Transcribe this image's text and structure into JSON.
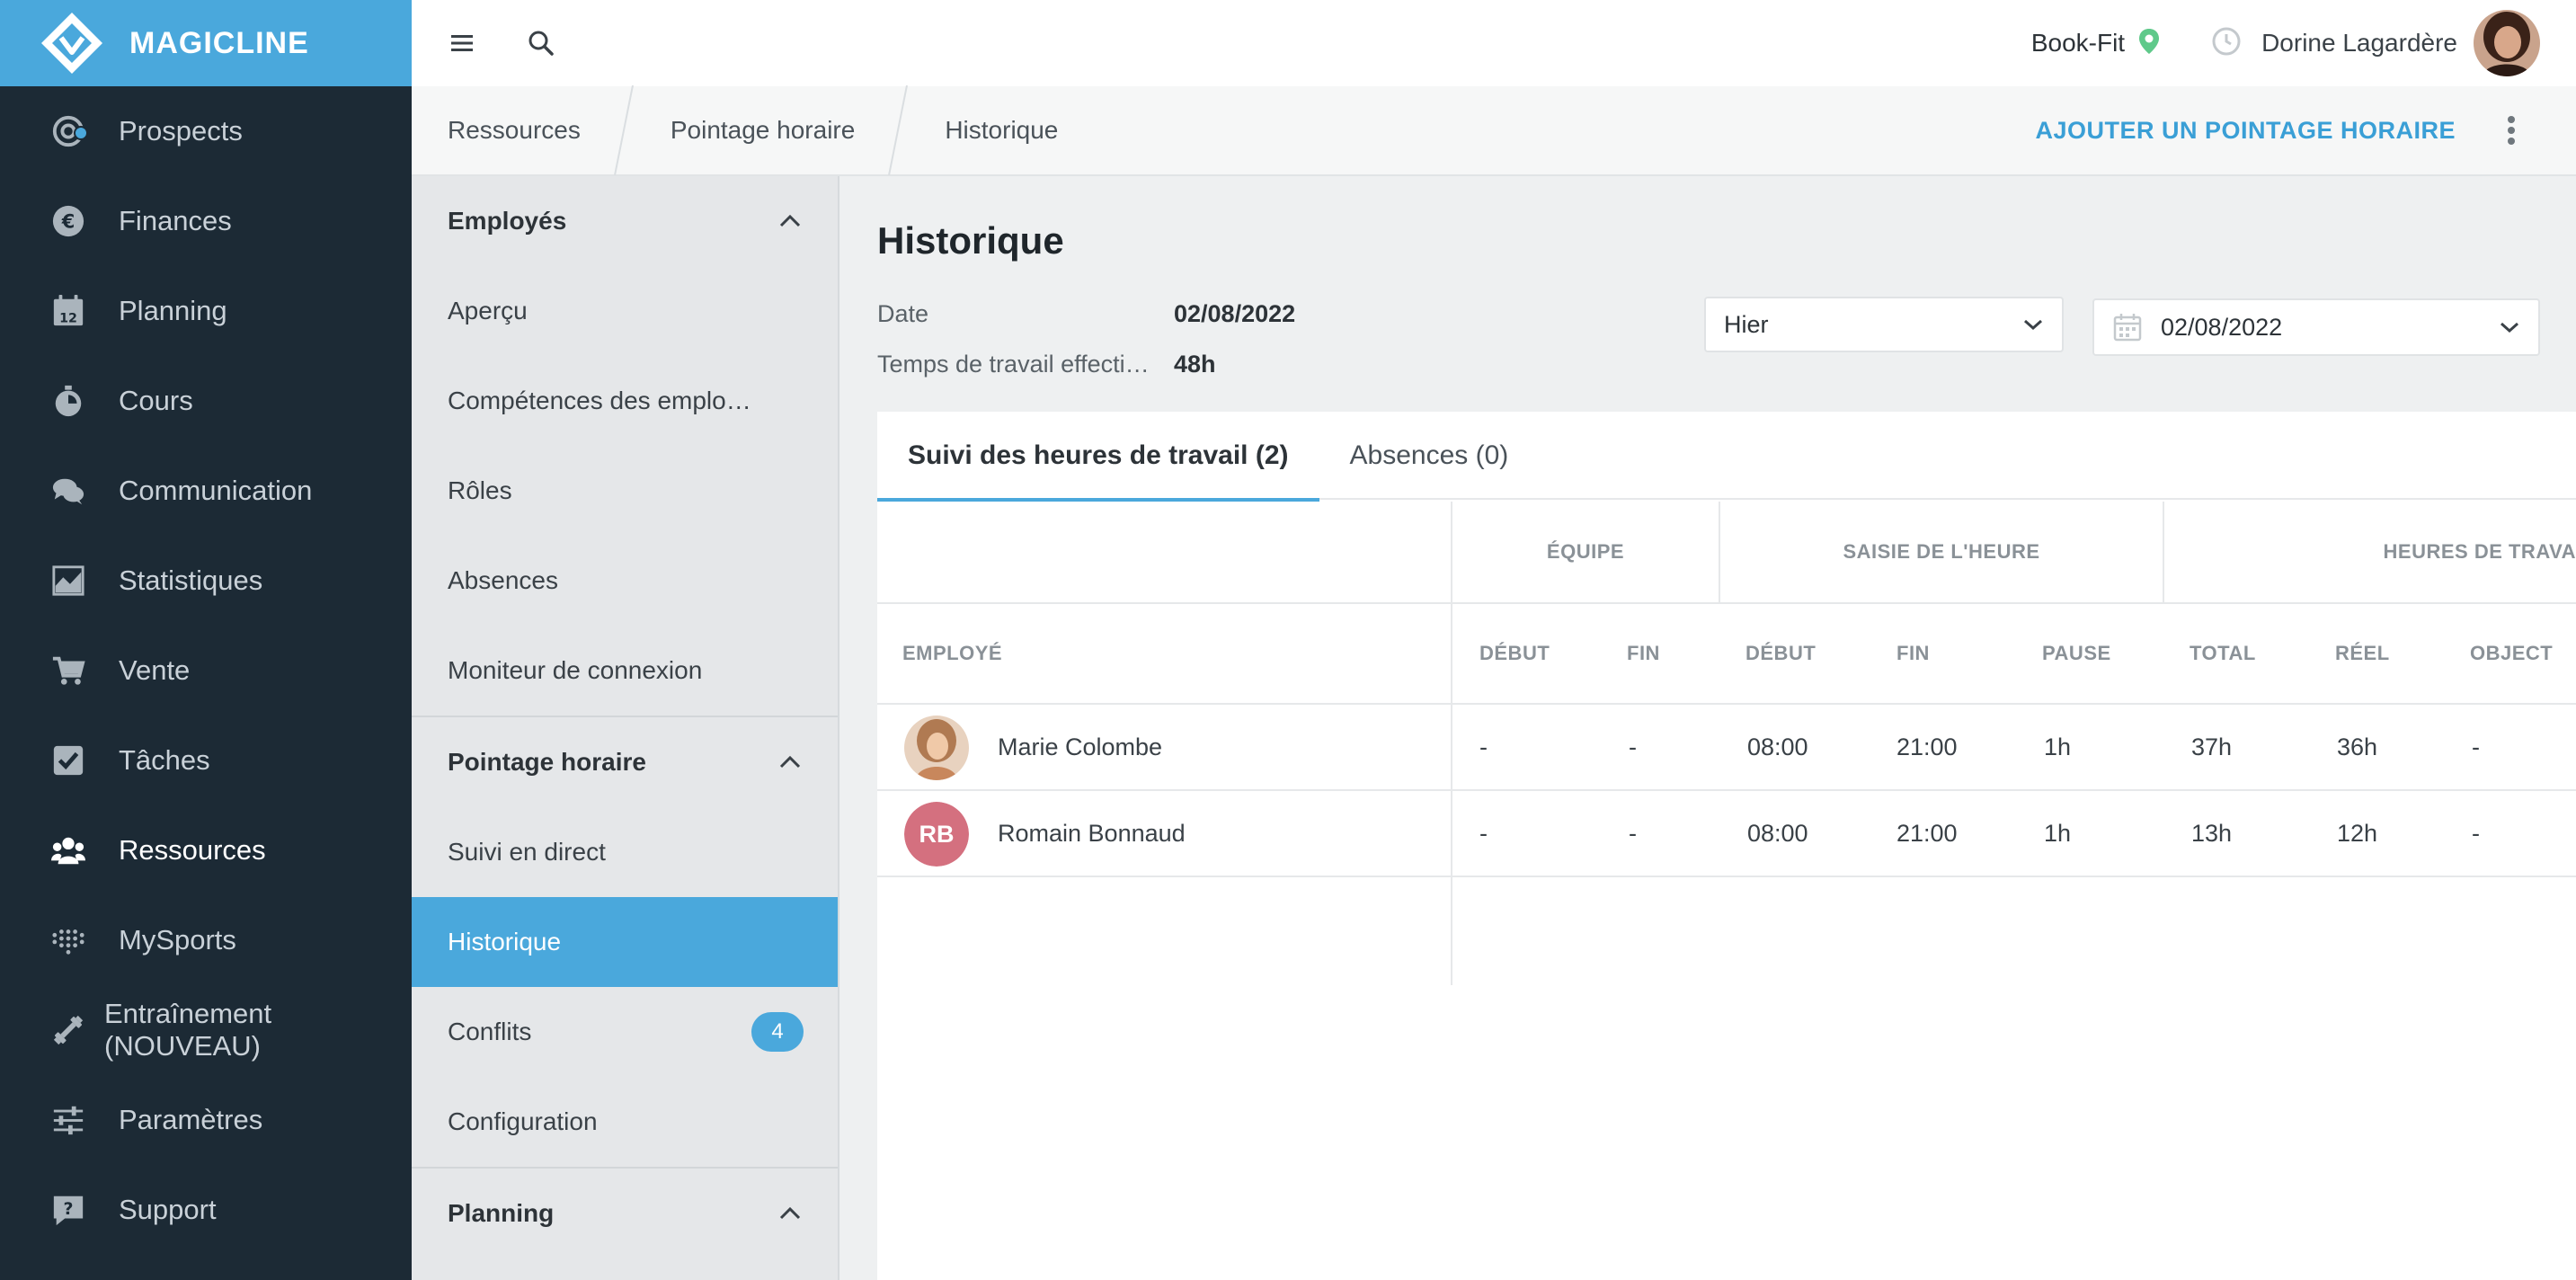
{
  "brand": {
    "name": "MAGICLINE",
    "color": "#4aa8dc"
  },
  "sidebar": {
    "items": [
      {
        "label": "Prospects",
        "icon": "target-icon"
      },
      {
        "label": "Finances",
        "icon": "euro-coin-icon"
      },
      {
        "label": "Planning",
        "icon": "calendar-icon"
      },
      {
        "label": "Cours",
        "icon": "stopwatch-icon"
      },
      {
        "label": "Communication",
        "icon": "chat-bubbles-icon"
      },
      {
        "label": "Statistiques",
        "icon": "area-chart-icon"
      },
      {
        "label": "Vente",
        "icon": "shopping-cart-icon"
      },
      {
        "label": "Tâches",
        "icon": "checkbox-icon"
      },
      {
        "label": "Ressources",
        "icon": "users-icon",
        "active": true
      },
      {
        "label": "MySports",
        "icon": "dots-grid-icon"
      },
      {
        "label": "Entraînement (NOUVEAU)",
        "icon": "dumbbell-icon"
      },
      {
        "label": "Paramètres",
        "icon": "sliders-icon"
      },
      {
        "label": "Support",
        "icon": "help-bubble-icon"
      }
    ]
  },
  "topbar": {
    "studio": "Book-Fit",
    "user_name": "Dorine Lagardère"
  },
  "breadcrumb": {
    "items": [
      "Ressources",
      "Pointage horaire",
      "Historique"
    ],
    "action_label": "AJOUTER UN POINTAGE HORAIRE"
  },
  "subnav": {
    "sections": [
      {
        "title": "Employés",
        "items": [
          "Aperçu",
          "Compétences des emplo…",
          "Rôles",
          "Absences",
          "Moniteur de connexion"
        ]
      },
      {
        "title": "Pointage horaire",
        "items": [
          "Suivi en direct",
          "Historique",
          "Conflits",
          "Configuration"
        ],
        "conflicts_badge": "4"
      },
      {
        "title": "Planning",
        "items": []
      }
    ]
  },
  "main": {
    "title": "Historique",
    "meta": [
      {
        "label": "Date",
        "value": "02/08/2022"
      },
      {
        "label": "Temps de travail effecti…",
        "value": "48h"
      }
    ],
    "period_select": "Hier",
    "date_select": "02/08/2022",
    "tabs": [
      "Suivi des heures de travail (2)",
      "Absences (0)"
    ],
    "table": {
      "groups": [
        "ÉQUIPE",
        "SAISIE DE L'HEURE",
        "HEURES DE TRAVA"
      ],
      "columns": [
        "EMPLOYÉ",
        "DÉBUT",
        "FIN",
        "DÉBUT",
        "FIN",
        "PAUSE",
        "TOTAL",
        "RÉEL",
        "OBJECT"
      ],
      "rows": [
        {
          "name": "Marie Colombe",
          "initials": "",
          "values": [
            "-",
            "-",
            "08:00",
            "21:00",
            "1h",
            "37h",
            "36h",
            "-"
          ]
        },
        {
          "name": "Romain Bonnaud",
          "initials": "RB",
          "values": [
            "-",
            "-",
            "08:00",
            "21:00",
            "1h",
            "13h",
            "12h",
            "-"
          ]
        }
      ]
    }
  }
}
